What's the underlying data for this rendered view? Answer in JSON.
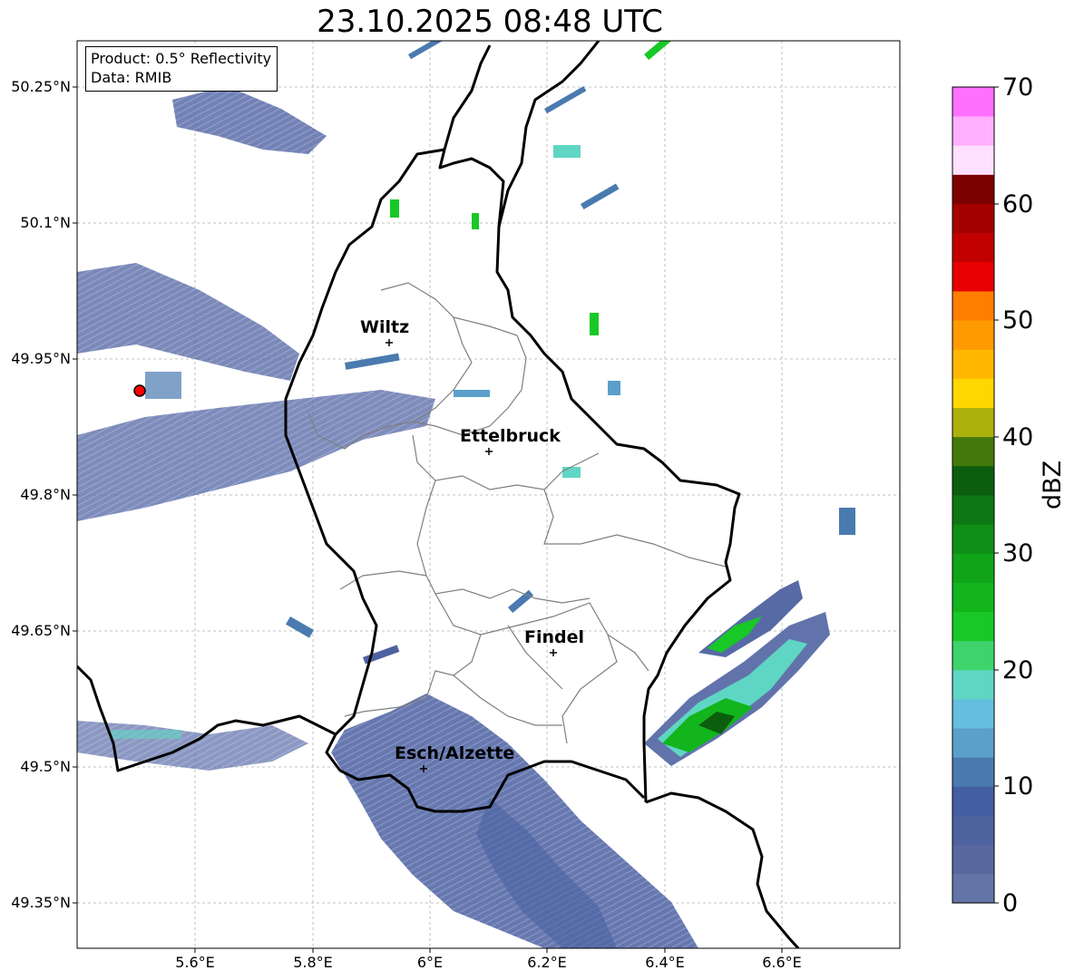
{
  "title": "23.10.2025 08:48 UTC",
  "info": {
    "product": "Product: 0.5° Reflectivity",
    "data": "Data: RMIB"
  },
  "lat_labels": [
    "50.25°N",
    "50.1°N",
    "49.95°N",
    "49.8°N",
    "49.65°N",
    "49.5°N",
    "49.35°N"
  ],
  "lon_labels": [
    "5.6°E",
    "5.8°E",
    "6°E",
    "6.2°E",
    "6.4°E",
    "6.6°E"
  ],
  "cities": [
    {
      "name": "Wiltz",
      "lon": 5.93,
      "lat": 49.966
    },
    {
      "name": "Ettelbruck",
      "lon": 6.1,
      "lat": 49.847
    },
    {
      "name": "Findel",
      "lon": 6.21,
      "lat": 49.627
    },
    {
      "name": "Esch/Alzette",
      "lon": 5.99,
      "lat": 49.496
    }
  ],
  "radar_site": {
    "lon": 5.505,
    "lat": 49.914
  },
  "colorbar": {
    "label": "dBZ",
    "ticks": [
      "70",
      "60",
      "50",
      "40",
      "30",
      "20",
      "10",
      "0"
    ],
    "min": 0,
    "max": 70,
    "step": 2.5,
    "colors": [
      "#6375a6",
      "#59689f",
      "#4e62a0",
      "#435ea2",
      "#4a7ab0",
      "#5aa0cb",
      "#63bfdd",
      "#5fd6c3",
      "#3ed46b",
      "#18c826",
      "#12b51c",
      "#10a419",
      "#0f8e16",
      "#0d7713",
      "#0b5e0e",
      "#43780a",
      "#acb10b",
      "#ffd700",
      "#ffb800",
      "#ff9a00",
      "#ff7e00",
      "#e80000",
      "#c20000",
      "#a50000",
      "#7d0000",
      "#ffe0ff",
      "#ffb0ff",
      "#ff70ff",
      "#ee30ee"
    ]
  },
  "legend_colors": {
    "border_country": "#000000",
    "border_canton": "#7f7f7f",
    "site_marker": "#ff0000",
    "grid": "#b0b0b0"
  }
}
